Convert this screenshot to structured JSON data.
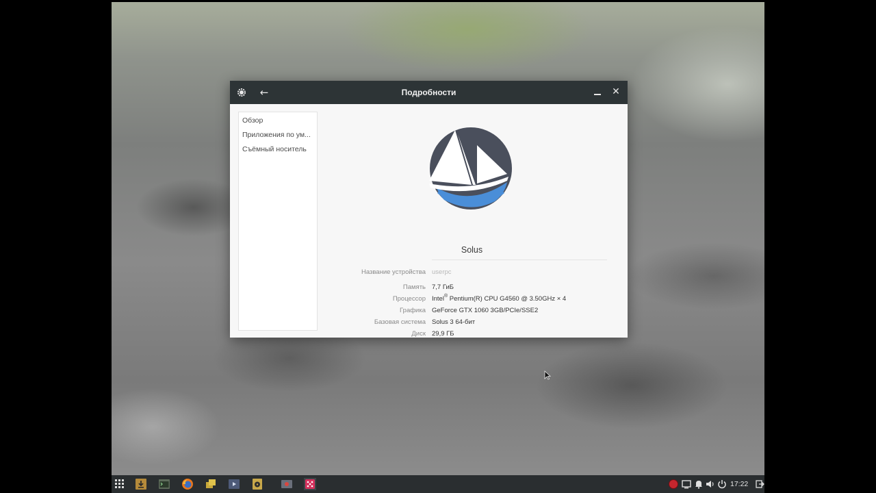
{
  "window": {
    "title": "Подробности",
    "back_label": "←",
    "close_label": "✕"
  },
  "sidebar": {
    "items": [
      {
        "label": "Обзор"
      },
      {
        "label": "Приложения по ум..."
      },
      {
        "label": "Съёмный носитель"
      }
    ]
  },
  "about": {
    "os_name": "Solus",
    "device_name_label": "Название устройства",
    "device_name_value": "userpc",
    "memory_label": "Память",
    "memory_value": "7,7 ГиБ",
    "processor_label": "Процессор",
    "processor_brand": "Intel",
    "processor_reg": "®",
    "processor_rest": " Pentium(R) CPU G4560 @ 3.50GHz × 4",
    "graphics_label": "Графика",
    "graphics_value": "GeForce GTX 1060 3GB/PCIe/SSE2",
    "base_system_label": "Базовая система",
    "base_system_value": "Solus 3 64-бит",
    "disk_label": "Диск",
    "disk_value": "29,9 ГБ"
  },
  "taskbar": {
    "clock": "17:22",
    "apps": [
      "apps-grid-icon",
      "downloads-icon",
      "terminal-icon",
      "firefox-icon",
      "files-icon",
      "video-player-icon",
      "rhythmbox-icon",
      "screen-recorder-icon",
      "settings-app-icon"
    ],
    "tray": [
      "record-indicator-icon",
      "display-icon",
      "notifications-icon",
      "volume-icon",
      "power-icon",
      "logout-icon"
    ]
  },
  "colors": {
    "titlebar": "#2d3436",
    "taskbar": "#2a2e30",
    "logo_dark": "#4a4f5c",
    "logo_blue": "#4a8ed8"
  }
}
